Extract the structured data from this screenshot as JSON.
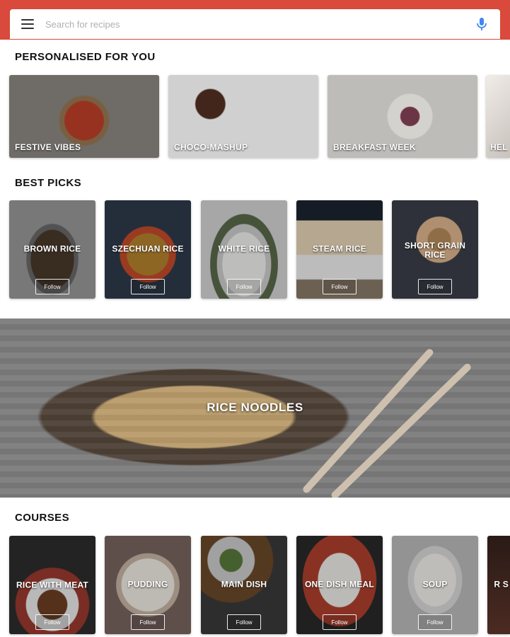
{
  "search": {
    "placeholder": "Search for recipes"
  },
  "personalised": {
    "title": "PERSONALISED FOR YOU",
    "cards": [
      {
        "label": "FESTIVE VIBES"
      },
      {
        "label": "CHOCO-MASHUP"
      },
      {
        "label": "BREAKFAST WEEK"
      },
      {
        "label": "HEL"
      }
    ]
  },
  "best_picks": {
    "title": "BEST PICKS",
    "follow_label": "Follow",
    "cards": [
      {
        "label": "BROWN RICE"
      },
      {
        "label": "SZECHUAN RICE"
      },
      {
        "label": "WHITE RICE"
      },
      {
        "label": "STEAM RICE"
      },
      {
        "label": "SHORT GRAIN RICE"
      }
    ]
  },
  "banner": {
    "label": "RICE NOODLES"
  },
  "courses": {
    "title": "COURSES",
    "follow_label": "Follow",
    "cards": [
      {
        "label": "RICE WITH MEAT"
      },
      {
        "label": "PUDDING"
      },
      {
        "label": "MAIN DISH"
      },
      {
        "label": "ONE DISH MEAL"
      },
      {
        "label": "SOUP"
      },
      {
        "label": "R S"
      }
    ]
  },
  "colors": {
    "app_bar": "#d9493c",
    "mic_blue": "#4285f4"
  }
}
